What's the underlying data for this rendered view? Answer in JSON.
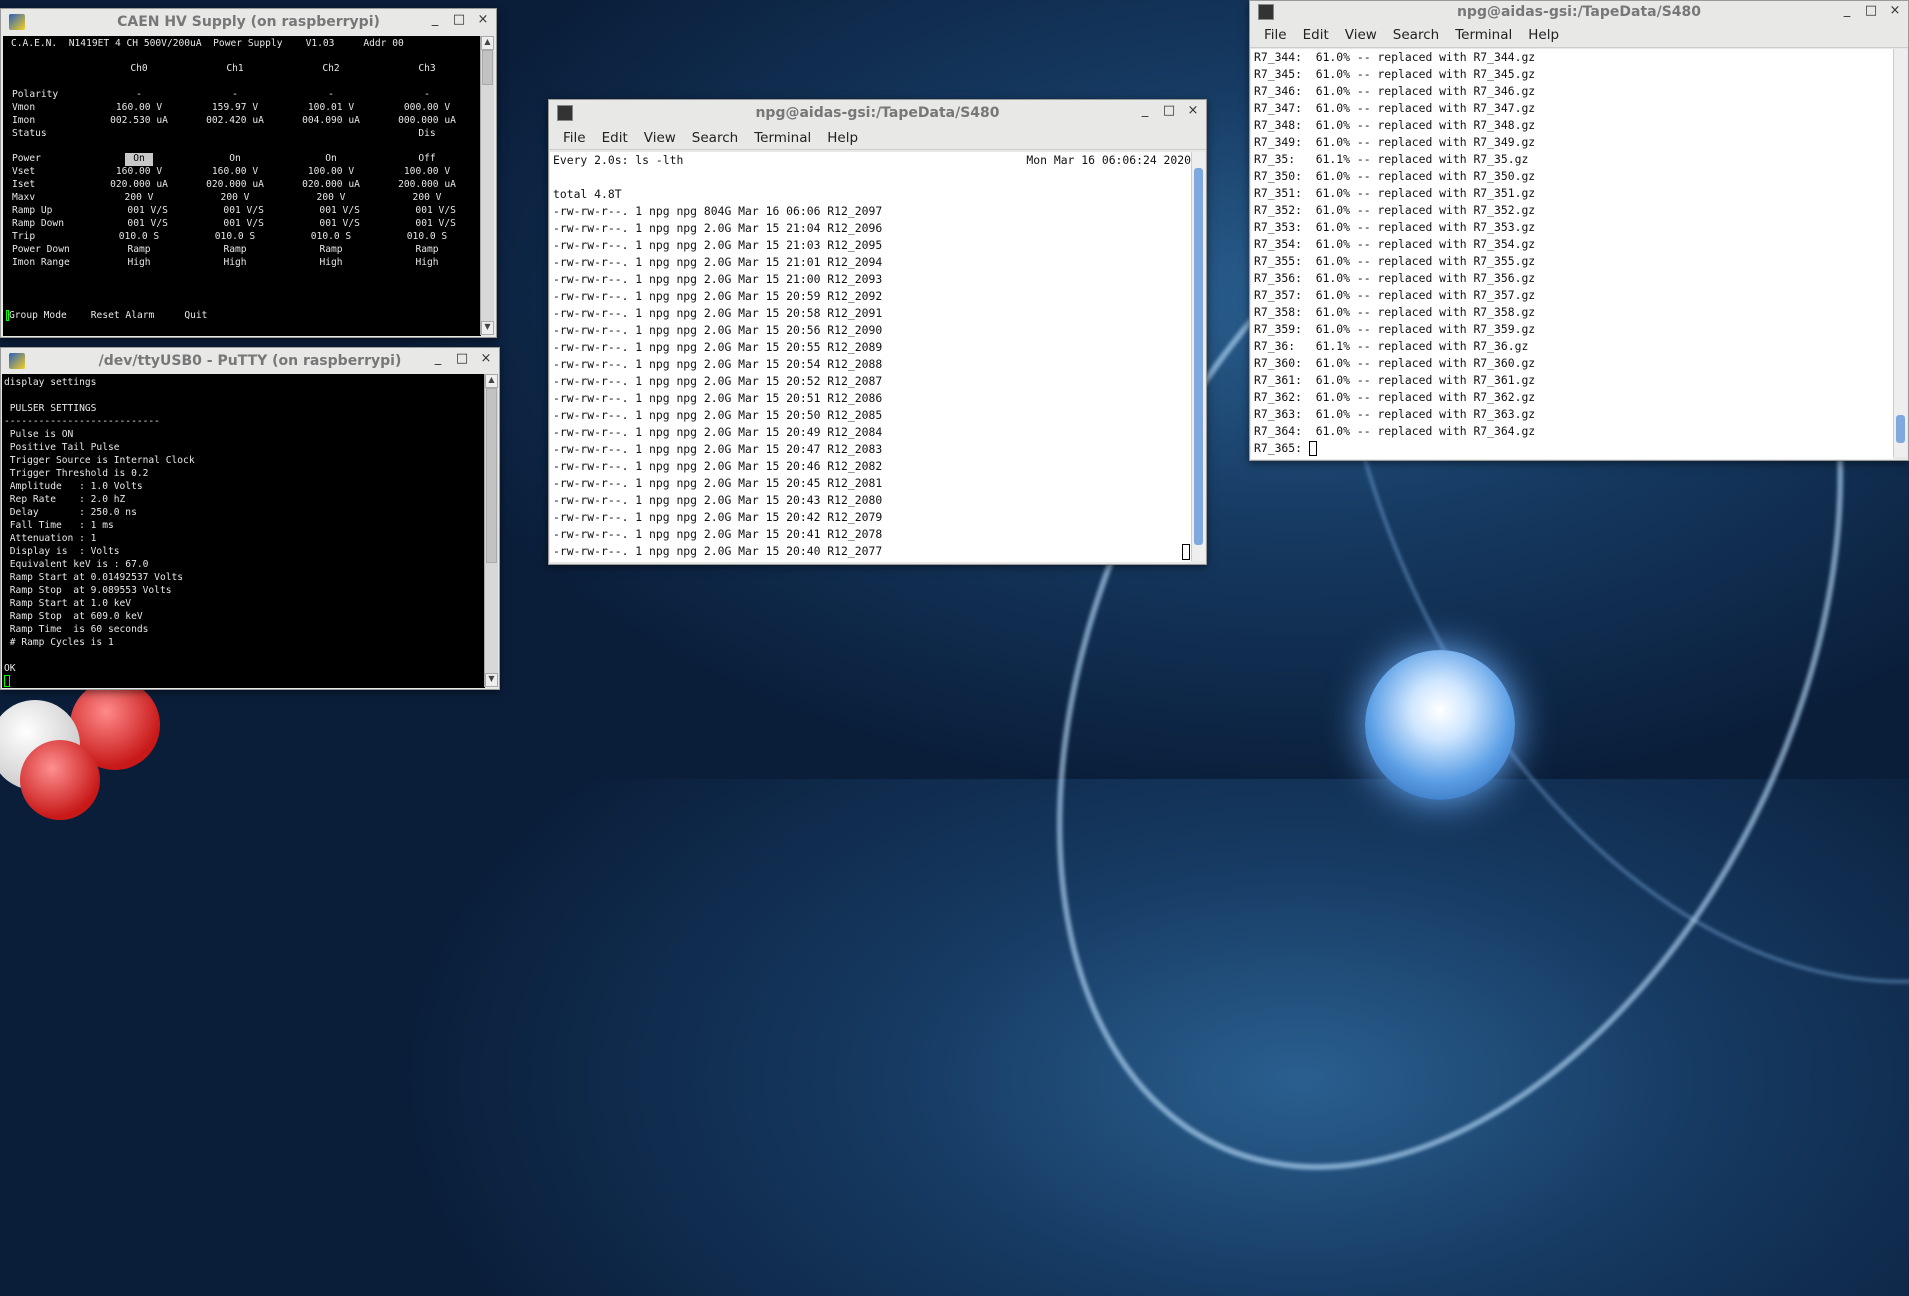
{
  "caen": {
    "title": "CAEN HV Supply (on raspberrypi)",
    "header": "C.A.E.N.  N1419ET 4 CH 500V/200uA  Power Supply    V1.03     Addr 00",
    "channels": [
      "Ch0",
      "Ch1",
      "Ch2",
      "Ch3"
    ],
    "rows1": [
      {
        "label": "Polarity",
        "values": [
          "-",
          "-",
          "-",
          "-"
        ]
      },
      {
        "label": "Vmon",
        "values": [
          "160.00 V",
          "159.97 V",
          "100.01 V",
          "000.00 V"
        ]
      },
      {
        "label": "Imon",
        "values": [
          "002.530 uA",
          "002.420 uA",
          "004.090 uA",
          "000.000 uA"
        ]
      },
      {
        "label": "Status",
        "values": [
          "",
          "",
          "",
          "Dis"
        ]
      }
    ],
    "rows2": [
      {
        "label": "Power",
        "values": [
          "On",
          "On",
          "On",
          "Off"
        ]
      },
      {
        "label": "Vset",
        "values": [
          "160.00 V",
          "160.00 V",
          "100.00 V",
          "100.00 V"
        ]
      },
      {
        "label": "Iset",
        "values": [
          "020.000 uA",
          "020.000 uA",
          "020.000 uA",
          "200.000 uA"
        ]
      },
      {
        "label": "Maxv",
        "values": [
          "200 V",
          "200 V",
          "200 V",
          "200 V"
        ]
      },
      {
        "label": "Ramp Up",
        "values": [
          "   001 V/S",
          "   001 V/S",
          "   001 V/S",
          "   001 V/S"
        ]
      },
      {
        "label": "Ramp Down",
        "values": [
          "   001 V/S",
          "   001 V/S",
          "   001 V/S",
          "   001 V/S"
        ]
      },
      {
        "label": "Trip",
        "values": [
          "010.0 S",
          "010.0 S",
          "010.0 S",
          "010.0 S"
        ]
      },
      {
        "label": "Power Down",
        "values": [
          "Ramp",
          "Ramp",
          "Ramp",
          "Ramp"
        ]
      },
      {
        "label": "Imon Range",
        "values": [
          "High",
          "High",
          "High",
          "High"
        ]
      }
    ],
    "actions": [
      "Group Mode",
      "Reset Alarm",
      "Quit"
    ]
  },
  "putty": {
    "title": "/dev/ttyUSB0 - PuTTY (on raspberrypi)",
    "lines": [
      "display settings",
      "",
      " PULSER SETTINGS",
      "---------------------------",
      " Pulse is ON",
      " Positive Tail Pulse",
      " Trigger Source is Internal Clock",
      " Trigger Threshold is 0.2",
      " Amplitude   : 1.0 Volts",
      " Rep Rate    : 2.0 hZ",
      " Delay       : 250.0 ns",
      " Fall Time   : 1 ms",
      " Attenuation : 1",
      " Display is  : Volts",
      " Equivalent keV is : 67.0",
      " Ramp Start at 0.01492537 Volts",
      " Ramp Stop  at 9.089553 Volts",
      " Ramp Start at 1.0 keV",
      " Ramp Stop  at 609.0 keV",
      " Ramp Time  is 60 seconds",
      " # Ramp Cycles is 1",
      "",
      "OK"
    ]
  },
  "term1": {
    "title": "npg@aidas-gsi:/TapeData/S480",
    "menu": [
      "File",
      "Edit",
      "View",
      "Search",
      "Terminal",
      "Help"
    ],
    "command": "Every 2.0s: ls -lth",
    "clock": "Mon Mar 16 06:06:24 2020",
    "total": "total 4.8T",
    "files": [
      "-rw-rw-r--. 1 npg npg 804G Mar 16 06:06 R12_2097",
      "-rw-rw-r--. 1 npg npg 2.0G Mar 15 21:04 R12_2096",
      "-rw-rw-r--. 1 npg npg 2.0G Mar 15 21:03 R12_2095",
      "-rw-rw-r--. 1 npg npg 2.0G Mar 15 21:01 R12_2094",
      "-rw-rw-r--. 1 npg npg 2.0G Mar 15 21:00 R12_2093",
      "-rw-rw-r--. 1 npg npg 2.0G Mar 15 20:59 R12_2092",
      "-rw-rw-r--. 1 npg npg 2.0G Mar 15 20:58 R12_2091",
      "-rw-rw-r--. 1 npg npg 2.0G Mar 15 20:56 R12_2090",
      "-rw-rw-r--. 1 npg npg 2.0G Mar 15 20:55 R12_2089",
      "-rw-rw-r--. 1 npg npg 2.0G Mar 15 20:54 R12_2088",
      "-rw-rw-r--. 1 npg npg 2.0G Mar 15 20:52 R12_2087",
      "-rw-rw-r--. 1 npg npg 2.0G Mar 15 20:51 R12_2086",
      "-rw-rw-r--. 1 npg npg 2.0G Mar 15 20:50 R12_2085",
      "-rw-rw-r--. 1 npg npg 2.0G Mar 15 20:49 R12_2084",
      "-rw-rw-r--. 1 npg npg 2.0G Mar 15 20:47 R12_2083",
      "-rw-rw-r--. 1 npg npg 2.0G Mar 15 20:46 R12_2082",
      "-rw-rw-r--. 1 npg npg 2.0G Mar 15 20:45 R12_2081",
      "-rw-rw-r--. 1 npg npg 2.0G Mar 15 20:43 R12_2080",
      "-rw-rw-r--. 1 npg npg 2.0G Mar 15 20:42 R12_2079",
      "-rw-rw-r--. 1 npg npg 2.0G Mar 15 20:41 R12_2078",
      "-rw-rw-r--. 1 npg npg 2.0G Mar 15 20:40 R12_2077"
    ]
  },
  "term2": {
    "title": "npg@aidas-gsi:/TapeData/S480",
    "menu": [
      "File",
      "Edit",
      "View",
      "Search",
      "Terminal",
      "Help"
    ],
    "lines": [
      "R7_344:  61.0% -- replaced with R7_344.gz",
      "R7_345:  61.0% -- replaced with R7_345.gz",
      "R7_346:  61.0% -- replaced with R7_346.gz",
      "R7_347:  61.0% -- replaced with R7_347.gz",
      "R7_348:  61.0% -- replaced with R7_348.gz",
      "R7_349:  61.0% -- replaced with R7_349.gz",
      "R7_35:   61.1% -- replaced with R7_35.gz",
      "R7_350:  61.0% -- replaced with R7_350.gz",
      "R7_351:  61.0% -- replaced with R7_351.gz",
      "R7_352:  61.0% -- replaced with R7_352.gz",
      "R7_353:  61.0% -- replaced with R7_353.gz",
      "R7_354:  61.0% -- replaced with R7_354.gz",
      "R7_355:  61.0% -- replaced with R7_355.gz",
      "R7_356:  61.0% -- replaced with R7_356.gz",
      "R7_357:  61.0% -- replaced with R7_357.gz",
      "R7_358:  61.0% -- replaced with R7_358.gz",
      "R7_359:  61.0% -- replaced with R7_359.gz",
      "R7_36:   61.1% -- replaced with R7_36.gz",
      "R7_360:  61.0% -- replaced with R7_360.gz",
      "R7_361:  61.0% -- replaced with R7_361.gz",
      "R7_362:  61.0% -- replaced with R7_362.gz",
      "R7_363:  61.0% -- replaced with R7_363.gz",
      "R7_364:  61.0% -- replaced with R7_364.gz"
    ],
    "prompt": "R7_365: "
  },
  "window_buttons": {
    "minimize": "_",
    "maximize": "□",
    "close": "×"
  }
}
